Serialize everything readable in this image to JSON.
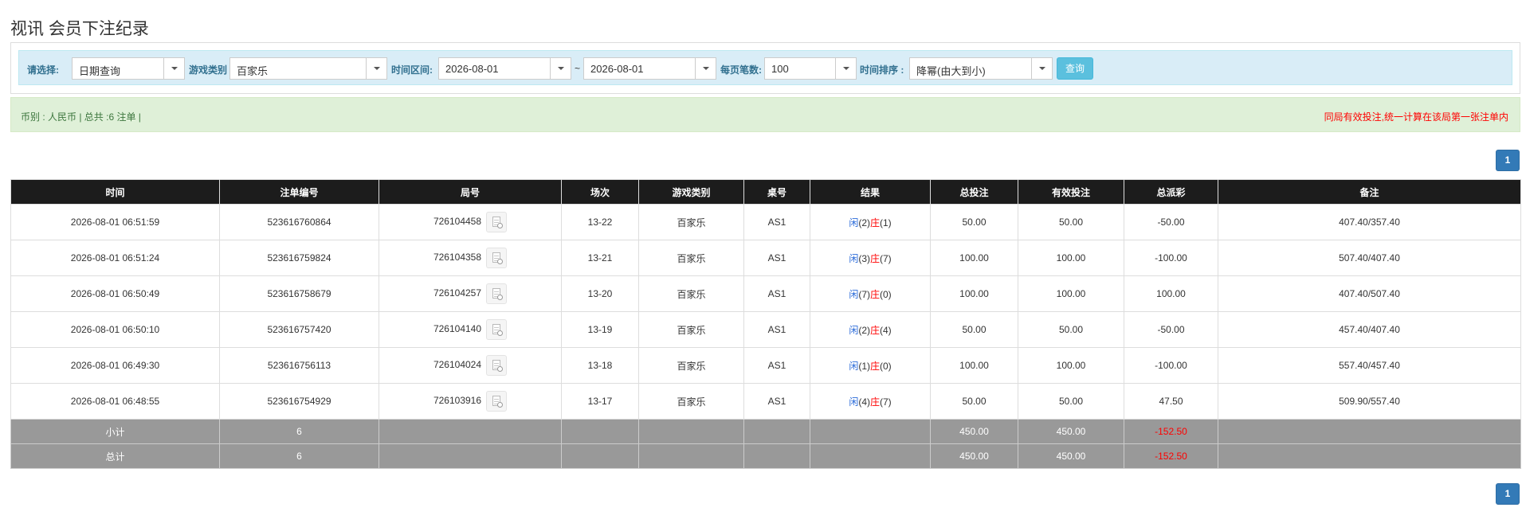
{
  "page": {
    "title": "视讯 会员下注纪录"
  },
  "filter": {
    "select_label": "请选择:",
    "select_value": "日期查询",
    "game_type_label": "游戏类别",
    "game_type_value": "百家乐",
    "time_range_label": "时间区间:",
    "date_from": "2026-08-01",
    "tilde": "~",
    "date_to": "2026-08-01",
    "page_size_label": "每页笔数:",
    "page_size_value": "100",
    "sort_label": "时间排序 :",
    "sort_value": "降幂(由大到小)",
    "query_button": "查询"
  },
  "info": {
    "summary": "币别 : 人民币 | 总共 :6 注单 |",
    "notice": "同局有效投注,统一计算在该局第一张注单内"
  },
  "pagination": {
    "current_page": "1"
  },
  "table": {
    "headers": [
      "时间",
      "注单编号",
      "局号",
      "场次",
      "游戏类别",
      "桌号",
      "结果",
      "总投注",
      "有效投注",
      "总派彩",
      "备注"
    ],
    "result_player_label": "闲",
    "result_banker_label": "庄",
    "rows": [
      {
        "time": "2026-08-01 06:51:59",
        "bet_id": "523616760864",
        "round": "726104458",
        "shoe": "13-22",
        "game": "百家乐",
        "table": "AS1",
        "player_score": "(2)",
        "banker_score": "(1)",
        "total_bet": "50.00",
        "valid_bet": "50.00",
        "payout": "-50.00",
        "payout_color": "red",
        "note": "407.40/357.40"
      },
      {
        "time": "2026-08-01 06:51:24",
        "bet_id": "523616759824",
        "round": "726104358",
        "shoe": "13-21",
        "game": "百家乐",
        "table": "AS1",
        "player_score": "(3)",
        "banker_score": "(7)",
        "total_bet": "100.00",
        "valid_bet": "100.00",
        "payout": "-100.00",
        "payout_color": "red",
        "note": "507.40/407.40"
      },
      {
        "time": "2026-08-01 06:50:49",
        "bet_id": "523616758679",
        "round": "726104257",
        "shoe": "13-20",
        "game": "百家乐",
        "table": "AS1",
        "player_score": "(7)",
        "banker_score": "(0)",
        "total_bet": "100.00",
        "valid_bet": "100.00",
        "payout": "100.00",
        "payout_color": "black",
        "note": "407.40/507.40"
      },
      {
        "time": "2026-08-01 06:50:10",
        "bet_id": "523616757420",
        "round": "726104140",
        "shoe": "13-19",
        "game": "百家乐",
        "table": "AS1",
        "player_score": "(2)",
        "banker_score": "(4)",
        "total_bet": "50.00",
        "valid_bet": "50.00",
        "payout": "-50.00",
        "payout_color": "red",
        "note": "457.40/407.40"
      },
      {
        "time": "2026-08-01 06:49:30",
        "bet_id": "523616756113",
        "round": "726104024",
        "shoe": "13-18",
        "game": "百家乐",
        "table": "AS1",
        "player_score": "(1)",
        "banker_score": "(0)",
        "total_bet": "100.00",
        "valid_bet": "100.00",
        "payout": "-100.00",
        "payout_color": "red",
        "note": "557.40/457.40"
      },
      {
        "time": "2026-08-01 06:48:55",
        "bet_id": "523616754929",
        "round": "726103916",
        "shoe": "13-17",
        "game": "百家乐",
        "table": "AS1",
        "player_score": "(4)",
        "banker_score": "(7)",
        "total_bet": "50.00",
        "valid_bet": "50.00",
        "payout": "47.50",
        "payout_color": "black",
        "note": "509.90/557.40"
      }
    ],
    "subtotal": {
      "label": "小计",
      "count": "6",
      "total_bet": "450.00",
      "valid_bet": "450.00",
      "payout": "-152.50"
    },
    "grandtotal": {
      "label": "总计",
      "count": "6",
      "total_bet": "450.00",
      "valid_bet": "450.00",
      "payout": "-152.50"
    }
  },
  "icons": {
    "replay": "replay-record-icon",
    "caret": "caret-down-icon"
  },
  "colors": {
    "header_bg": "#1c1c1c",
    "filter_bg": "#d9edf7",
    "info_bg": "#dff0d8",
    "summary_bg": "#999999",
    "link_blue": "#2a6ad9",
    "negative_red": "#ff0000",
    "button_blue": "#5bc0de",
    "pager_blue": "#337ab7"
  }
}
